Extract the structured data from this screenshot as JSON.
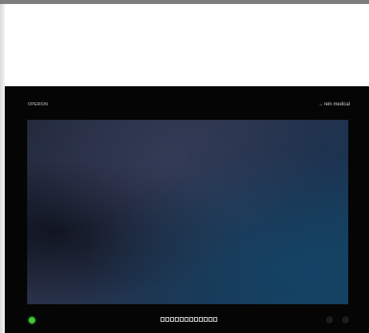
{
  "monitor": {
    "brand_left": "OPERION",
    "brand_right": "rein medical",
    "brand_mark_icon": "rein-logo-mark-icon",
    "power_led_color": "#3ec83a",
    "screen_colors": {
      "dark": "#232a3d",
      "accent_blue": "#14405e"
    },
    "button_strip": [
      {
        "glyph": "▣",
        "icon": "button-1-icon"
      },
      {
        "glyph": "▣",
        "icon": "button-2-icon"
      },
      {
        "glyph": "▣",
        "icon": "button-3-icon"
      },
      {
        "glyph": "▣",
        "icon": "button-4-icon"
      },
      {
        "glyph": "▣",
        "icon": "button-5-icon"
      },
      {
        "glyph": "▣",
        "icon": "button-6-icon"
      },
      {
        "glyph": "▣",
        "icon": "button-7-icon"
      },
      {
        "glyph": "▣",
        "icon": "button-8-icon"
      },
      {
        "glyph": "▣",
        "icon": "button-9-icon"
      },
      {
        "glyph": "▣",
        "icon": "button-10-icon"
      },
      {
        "glyph": "▣",
        "icon": "button-11-icon"
      },
      {
        "glyph": "▣",
        "icon": "button-12-icon"
      }
    ]
  }
}
